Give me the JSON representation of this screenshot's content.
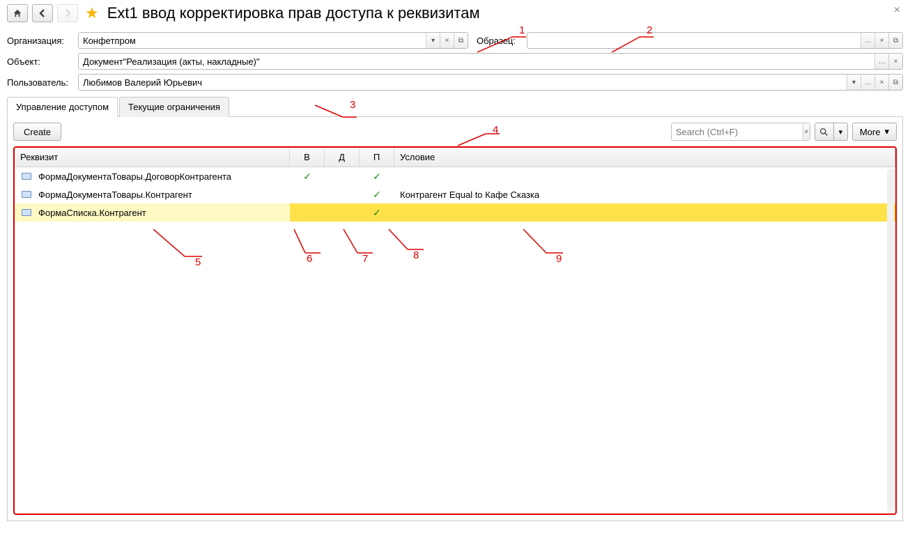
{
  "header": {
    "title": "Ext1 ввод корректировка прав доступа к реквизитам"
  },
  "form": {
    "org_label": "Организация:",
    "org_value": "Конфетпром",
    "obrazec_label": "Образец:",
    "obrazec_value": "",
    "object_label": "Объект:",
    "object_value": "Документ\"Реализация (акты, накладные)\"",
    "user_label": "Пользователь:",
    "user_value": "Любимов Валерий Юрьевич"
  },
  "tabs": {
    "t1": "Управление доступом",
    "t2": "Текущие ограничения"
  },
  "toolbar": {
    "create": "Create",
    "search_placeholder": "Search (Ctrl+F)",
    "more": "More"
  },
  "columns": {
    "req": "Реквизит",
    "v": "В",
    "d": "Д",
    "p": "П",
    "cond": "Условие"
  },
  "rows": [
    {
      "req": "ФормаДокументаТовары.ДоговорКонтрагента",
      "v": true,
      "d": false,
      "p": true,
      "cond": ""
    },
    {
      "req": "ФормаДокументаТовары.Контрагент",
      "v": false,
      "d": false,
      "p": true,
      "cond": "Контрагент Equal to Кафе Сказка"
    },
    {
      "req": "ФормаСписка.Контрагент",
      "v": false,
      "d": false,
      "p": true,
      "cond": "",
      "selected": true
    }
  ],
  "annotations": {
    "a1": "1",
    "a2": "2",
    "a3": "3",
    "a4": "4",
    "a5": "5",
    "a6": "6",
    "a7": "7",
    "a8": "8",
    "a9": "9"
  }
}
